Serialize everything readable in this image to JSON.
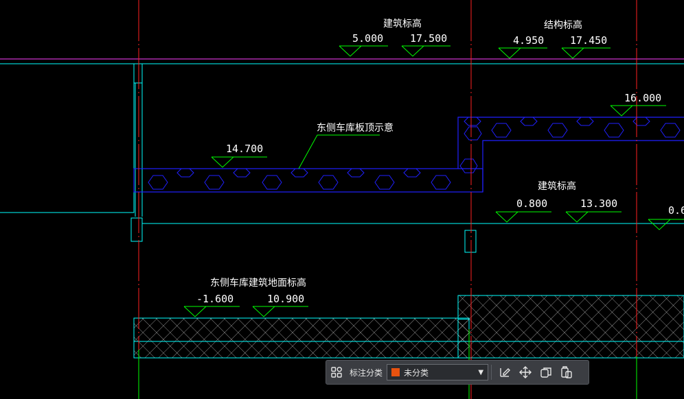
{
  "drawing": {
    "labels": {
      "arch_elev_top": "建筑标高",
      "struct_elev_top": "结构标高",
      "arch_elev_mid": "建筑标高",
      "slab_note": "东侧车库板顶示意",
      "floor_note": "东侧车库建筑地面标高"
    },
    "elevations": {
      "e1": "5.000",
      "e2": "17.500",
      "e3": "4.950",
      "e4": "17.450",
      "e5": "16.000",
      "e6": "14.700",
      "e7": "0.800",
      "e8": "13.300",
      "e9": "0.6",
      "e10": "-1.600",
      "e11": "10.900"
    },
    "colors": {
      "grid_axis": "#ff2020",
      "wall": "#00ffff",
      "slab": "#2020ff",
      "annotation": "#00ff00",
      "hatch": "#ffffff",
      "border": "#ff40ff"
    }
  },
  "toolbar": {
    "grid_icon": "grid-icon",
    "category_label": "标注分类",
    "category_value": "未分类",
    "category_color": "#e8520f",
    "tools": [
      "edit-icon",
      "move-icon",
      "copy-icon",
      "paste-icon"
    ]
  }
}
